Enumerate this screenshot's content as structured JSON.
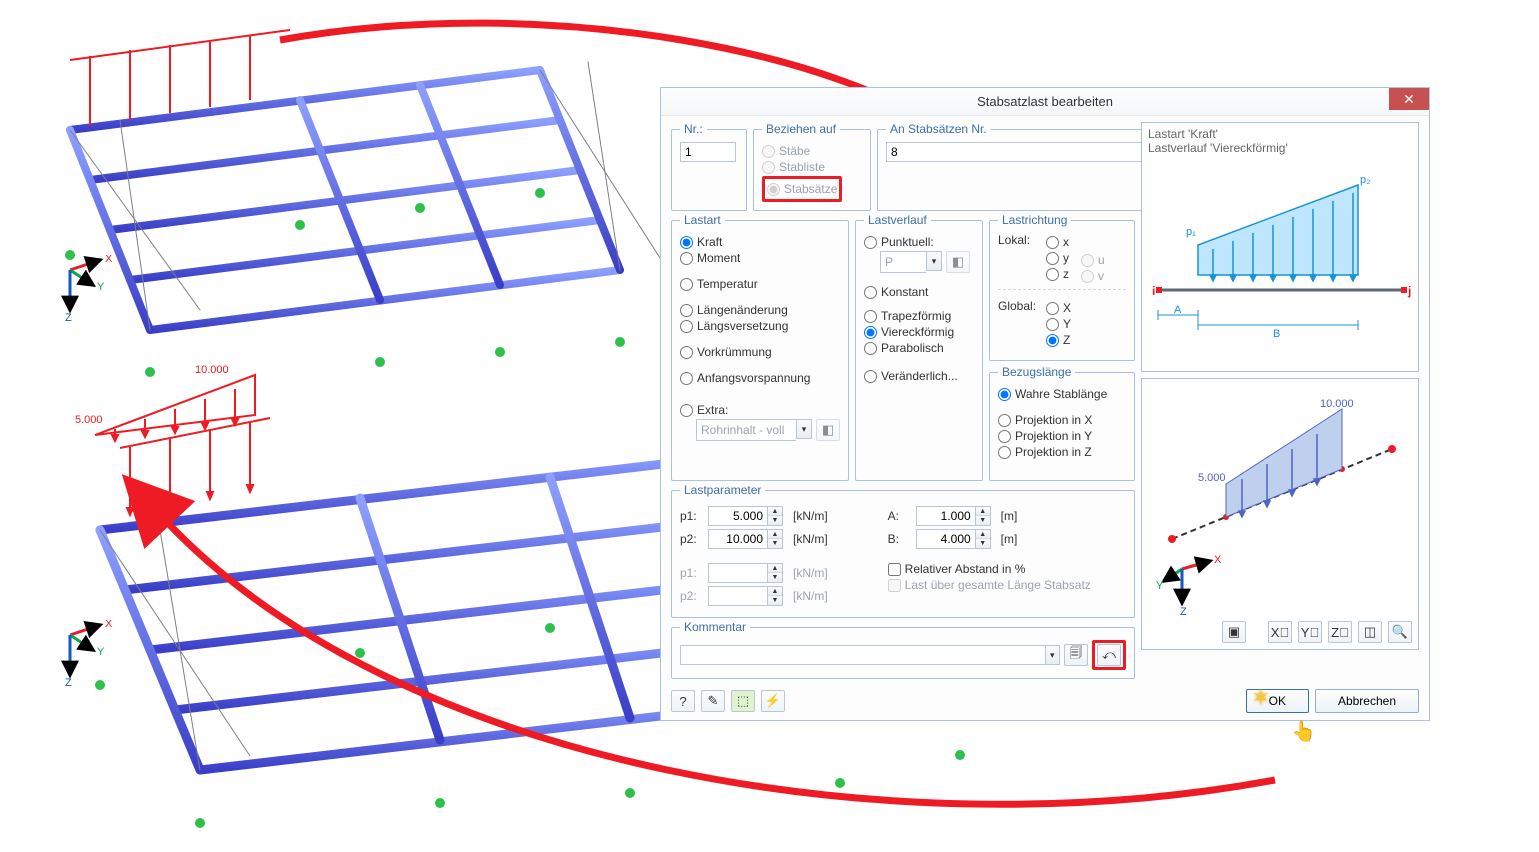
{
  "dialog": {
    "title": "Stabsatzlast bearbeiten",
    "nr_label": "Nr.:",
    "nr_value": "1",
    "beziehen_label": "Beziehen auf",
    "beziehen_options": {
      "staebe": "Stäbe",
      "stabliste": "Stabliste",
      "stabsaetze": "Stabsätze"
    },
    "an_stabsaetzen_label": "An Stabsätzen Nr.",
    "an_stabsaetzen_value": "8",
    "lastart_label": "Lastart",
    "lastart_options": {
      "kraft": "Kraft",
      "moment": "Moment",
      "temperatur": "Temperatur",
      "laengenaenderung": "Längenänderung",
      "laengsversetzung": "Längsversetzung",
      "vorkruemmung": "Vorkrümmung",
      "anfangsvorspannung": "Anfangsvorspannung",
      "extra": "Extra:"
    },
    "extra_combo": "Rohrinhalt - voll",
    "lastverlauf_label": "Lastverlauf",
    "lastverlauf_options": {
      "punktuell": "Punktuell:",
      "konstant": "Konstant",
      "trapezfoermig": "Trapezförmig",
      "viereckfoermig": "Viereckförmig",
      "parabolisch": "Parabolisch",
      "veraenderlich": "Veränderlich..."
    },
    "punktuell_combo": "P",
    "lastrichtung_label": "Lastrichtung",
    "lokal_label": "Lokal:",
    "lokal_options": {
      "x": "x",
      "y": "y",
      "z": "z",
      "u": "u",
      "v": "v"
    },
    "global_label": "Global:",
    "global_options": {
      "X": "X",
      "Y": "Y",
      "Z": "Z"
    },
    "bezugslaenge_label": "Bezugslänge",
    "bezugslaenge_options": {
      "wahre": "Wahre Stablänge",
      "projX": "Projektion in X",
      "projY": "Projektion in Y",
      "projZ": "Projektion in Z"
    },
    "preview_line1": "Lastart 'Kraft'",
    "preview_line2": "Lastverlauf 'Viereckförmig'",
    "diag_p1": "p₁",
    "diag_p2": "p₂",
    "diag_i": "i",
    "diag_j": "j",
    "diag_A": "A",
    "diag_B": "B",
    "lastparameter_label": "Lastparameter",
    "p1_label": "p1:",
    "p1_value": "5.000",
    "p1_unit": "[kN/m]",
    "p2_label": "p2:",
    "p2_value": "10.000",
    "p2_unit": "[kN/m]",
    "p1b_label": "p1:",
    "p1b_unit": "[kN/m]",
    "p2b_label": "p2:",
    "p2b_unit": "[kN/m]",
    "A_label": "A:",
    "A_value": "1.000",
    "A_unit": "[m]",
    "B_label": "B:",
    "B_value": "4.000",
    "B_unit": "[m]",
    "chk_relativ": "Relativer Abstand in %",
    "chk_gesamte": "Last über gesamte Länge Stabsatz",
    "preview3d_val1": "5.000",
    "preview3d_val2": "10.000",
    "kommentar_label": "Kommentar",
    "ok": "OK",
    "abbrechen": "Abbrechen"
  },
  "model": {
    "axes": {
      "x": "X",
      "y": "Y",
      "z": "Z"
    },
    "load1": "10.000",
    "load2": "5.000"
  }
}
